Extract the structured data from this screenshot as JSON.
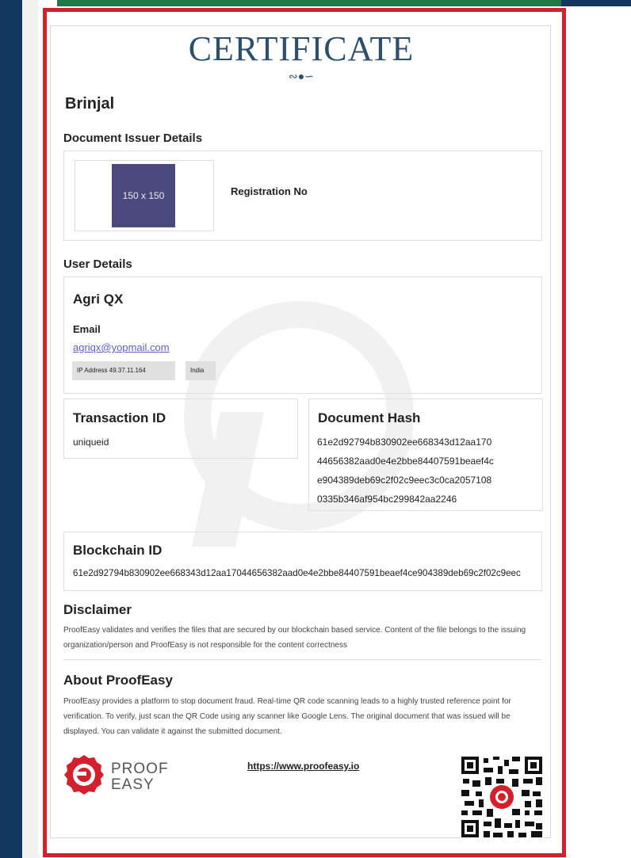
{
  "header": {
    "title": "CERTIFICATE",
    "swirl": "∾●∽"
  },
  "document": {
    "name": "Brinjal"
  },
  "issuer": {
    "section_label": "Document Issuer Details",
    "logo_placeholder": "150 x 150",
    "registration_label": "Registration No"
  },
  "user": {
    "section_label": "User Details",
    "name": "Agri QX",
    "email_label": "Email",
    "email": "agriqx@yopmail.com",
    "ip_badge": "IP Address 49.37.11.164",
    "country_badge": "India"
  },
  "transaction": {
    "label": "Transaction ID",
    "value": "uniqueid"
  },
  "hash": {
    "label": "Document Hash",
    "lines": [
      "61e2d92794b830902ee668343d12aa170",
      "44656382aad0e4e2bbe84407591beaef4c",
      "e904389deb69c2f02c9eec3c0ca2057108",
      "0335b346af954bc299842aa2246"
    ]
  },
  "blockchain": {
    "label": "Blockchain ID",
    "value": "61e2d92794b830902ee668343d12aa17044656382aad0e4e2bbe84407591beaef4ce904389deb69c2f02c9eec"
  },
  "disclaimer": {
    "title": "Disclaimer",
    "text": "ProofEasy validates and verifies the files that are secured by our blockchain based service. Content of the file belongs to the issuing organization/person and ProofEasy is not responsible for the content correctness"
  },
  "about": {
    "title": "About ProofEasy",
    "text": "ProofEasy provides a platform to stop document fraud. Real-time QR code scanning leads to a highly trusted reference point for verification. To verify, just scan the QR Code using any scanner like Google Lens. The original document that was issued will be displayed. You can validate it against the submitted document."
  },
  "footer": {
    "logo_word1": "PROOF",
    "logo_word2": "EASY",
    "link": "https://www.proofeasy.io"
  },
  "colors": {
    "frame": "#d4202c",
    "title": "#2b4f6c",
    "link": "#5e5ec9",
    "side_band": "#13365f",
    "top_band": "#1f7a4a"
  }
}
